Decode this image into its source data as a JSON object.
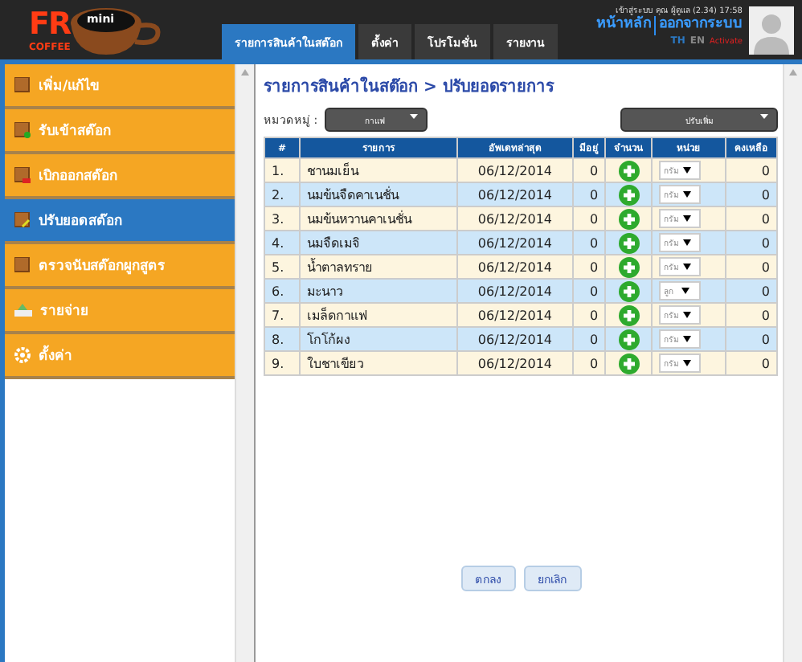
{
  "logo": {
    "brand": "FR",
    "sub": "COFFEE",
    "badge": "mini"
  },
  "tabs": [
    {
      "label": "รายการสินค้าในสต๊อก",
      "selected": true
    },
    {
      "label": "ตั้งค่า",
      "selected": false
    },
    {
      "label": "โปรโมชั่น",
      "selected": false
    },
    {
      "label": "รายงาน",
      "selected": false
    }
  ],
  "user": {
    "login_info": "เข้าสู่ระบบ คุณ ผู้ดูแล (2.34) 17:58",
    "home_link": "หน้าหลัก",
    "logout_link": "ออกจากระบบ"
  },
  "languages": [
    {
      "label": "TH",
      "selected": true
    },
    {
      "label": "EN",
      "selected": false
    }
  ],
  "activate_link": "Activate",
  "sidebar": {
    "items": [
      {
        "label": "เพิ่ม/แก้ไข",
        "selected": false,
        "kind": "box"
      },
      {
        "label": "รับเข้าสต๊อก",
        "selected": false,
        "kind": "box-in"
      },
      {
        "label": "เบิกออกสต๊อก",
        "selected": false,
        "kind": "box-out"
      },
      {
        "label": "ปรับยอดสต๊อก",
        "selected": true,
        "kind": "box-edit"
      },
      {
        "label": "ตรวจนับสต๊อกผูกสูตร",
        "selected": false,
        "kind": "box"
      },
      {
        "label": "รายจ่าย",
        "selected": false,
        "kind": "money"
      },
      {
        "label": "ตั้งค่า",
        "selected": false,
        "kind": "gear"
      }
    ]
  },
  "breadcrumb": "รายการสินค้าในสต๊อก > ปรับยอดรายการ",
  "category": {
    "label": "หมวดหมู่ :",
    "value": "กาแฟ"
  },
  "adjust_type": {
    "value": "ปรับเพิ่ม"
  },
  "table": {
    "columns": [
      "#",
      "รายการ",
      "อัพเดทล่าสุด",
      "มีอยู่",
      "จำนวน",
      "หน่วย",
      "คงเหลือ"
    ],
    "rows": [
      {
        "index": "1.",
        "name": "ชานมเย็น",
        "updated": "06/12/2014",
        "stock": "0",
        "unit": "กรัม",
        "remaining": "0"
      },
      {
        "index": "2.",
        "name": "นมข้นจืดคาเนชั่น",
        "updated": "06/12/2014",
        "stock": "0",
        "unit": "กรัม",
        "remaining": "0"
      },
      {
        "index": "3.",
        "name": "นมข้นหวานคาเนชั่น",
        "updated": "06/12/2014",
        "stock": "0",
        "unit": "กรัม",
        "remaining": "0"
      },
      {
        "index": "4.",
        "name": "นมจืดเมจิ",
        "updated": "06/12/2014",
        "stock": "0",
        "unit": "กรัม",
        "remaining": "0"
      },
      {
        "index": "5.",
        "name": "น้ำตาลทราย",
        "updated": "06/12/2014",
        "stock": "0",
        "unit": "กรัม",
        "remaining": "0"
      },
      {
        "index": "6.",
        "name": "มะนาว",
        "updated": "06/12/2014",
        "stock": "0",
        "unit": "ลูก",
        "remaining": "0"
      },
      {
        "index": "7.",
        "name": "เมล็ดกาแฟ",
        "updated": "06/12/2014",
        "stock": "0",
        "unit": "กรัม",
        "remaining": "0"
      },
      {
        "index": "8.",
        "name": "โกโก้ผง",
        "updated": "06/12/2014",
        "stock": "0",
        "unit": "กรัม",
        "remaining": "0"
      },
      {
        "index": "9.",
        "name": "ใบชาเขียว",
        "updated": "06/12/2014",
        "stock": "0",
        "unit": "กรัม",
        "remaining": "0"
      }
    ]
  },
  "buttons": [
    "ตกลง",
    "ยกเลิก"
  ]
}
